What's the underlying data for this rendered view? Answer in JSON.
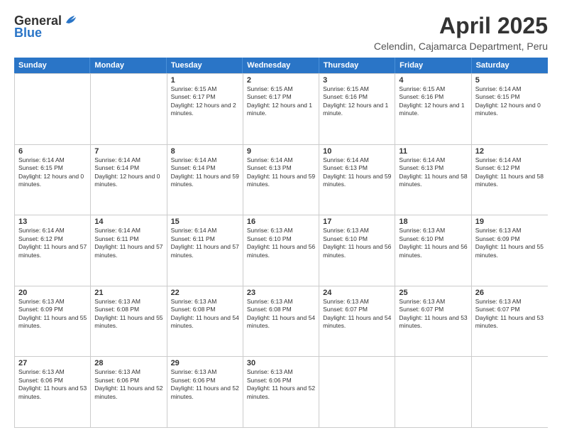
{
  "header": {
    "logo_general": "General",
    "logo_blue": "Blue",
    "main_title": "April 2025",
    "subtitle": "Celendin, Cajamarca Department, Peru"
  },
  "calendar": {
    "days_of_week": [
      "Sunday",
      "Monday",
      "Tuesday",
      "Wednesday",
      "Thursday",
      "Friday",
      "Saturday"
    ],
    "rows": [
      [
        {
          "day": "",
          "empty": true
        },
        {
          "day": "",
          "empty": true
        },
        {
          "day": "1",
          "sunrise": "Sunrise: 6:15 AM",
          "sunset": "Sunset: 6:17 PM",
          "daylight": "Daylight: 12 hours and 2 minutes."
        },
        {
          "day": "2",
          "sunrise": "Sunrise: 6:15 AM",
          "sunset": "Sunset: 6:17 PM",
          "daylight": "Daylight: 12 hours and 1 minute."
        },
        {
          "day": "3",
          "sunrise": "Sunrise: 6:15 AM",
          "sunset": "Sunset: 6:16 PM",
          "daylight": "Daylight: 12 hours and 1 minute."
        },
        {
          "day": "4",
          "sunrise": "Sunrise: 6:15 AM",
          "sunset": "Sunset: 6:16 PM",
          "daylight": "Daylight: 12 hours and 1 minute."
        },
        {
          "day": "5",
          "sunrise": "Sunrise: 6:14 AM",
          "sunset": "Sunset: 6:15 PM",
          "daylight": "Daylight: 12 hours and 0 minutes."
        }
      ],
      [
        {
          "day": "6",
          "sunrise": "Sunrise: 6:14 AM",
          "sunset": "Sunset: 6:15 PM",
          "daylight": "Daylight: 12 hours and 0 minutes."
        },
        {
          "day": "7",
          "sunrise": "Sunrise: 6:14 AM",
          "sunset": "Sunset: 6:14 PM",
          "daylight": "Daylight: 12 hours and 0 minutes."
        },
        {
          "day": "8",
          "sunrise": "Sunrise: 6:14 AM",
          "sunset": "Sunset: 6:14 PM",
          "daylight": "Daylight: 11 hours and 59 minutes."
        },
        {
          "day": "9",
          "sunrise": "Sunrise: 6:14 AM",
          "sunset": "Sunset: 6:13 PM",
          "daylight": "Daylight: 11 hours and 59 minutes."
        },
        {
          "day": "10",
          "sunrise": "Sunrise: 6:14 AM",
          "sunset": "Sunset: 6:13 PM",
          "daylight": "Daylight: 11 hours and 59 minutes."
        },
        {
          "day": "11",
          "sunrise": "Sunrise: 6:14 AM",
          "sunset": "Sunset: 6:13 PM",
          "daylight": "Daylight: 11 hours and 58 minutes."
        },
        {
          "day": "12",
          "sunrise": "Sunrise: 6:14 AM",
          "sunset": "Sunset: 6:12 PM",
          "daylight": "Daylight: 11 hours and 58 minutes."
        }
      ],
      [
        {
          "day": "13",
          "sunrise": "Sunrise: 6:14 AM",
          "sunset": "Sunset: 6:12 PM",
          "daylight": "Daylight: 11 hours and 57 minutes."
        },
        {
          "day": "14",
          "sunrise": "Sunrise: 6:14 AM",
          "sunset": "Sunset: 6:11 PM",
          "daylight": "Daylight: 11 hours and 57 minutes."
        },
        {
          "day": "15",
          "sunrise": "Sunrise: 6:14 AM",
          "sunset": "Sunset: 6:11 PM",
          "daylight": "Daylight: 11 hours and 57 minutes."
        },
        {
          "day": "16",
          "sunrise": "Sunrise: 6:13 AM",
          "sunset": "Sunset: 6:10 PM",
          "daylight": "Daylight: 11 hours and 56 minutes."
        },
        {
          "day": "17",
          "sunrise": "Sunrise: 6:13 AM",
          "sunset": "Sunset: 6:10 PM",
          "daylight": "Daylight: 11 hours and 56 minutes."
        },
        {
          "day": "18",
          "sunrise": "Sunrise: 6:13 AM",
          "sunset": "Sunset: 6:10 PM",
          "daylight": "Daylight: 11 hours and 56 minutes."
        },
        {
          "day": "19",
          "sunrise": "Sunrise: 6:13 AM",
          "sunset": "Sunset: 6:09 PM",
          "daylight": "Daylight: 11 hours and 55 minutes."
        }
      ],
      [
        {
          "day": "20",
          "sunrise": "Sunrise: 6:13 AM",
          "sunset": "Sunset: 6:09 PM",
          "daylight": "Daylight: 11 hours and 55 minutes."
        },
        {
          "day": "21",
          "sunrise": "Sunrise: 6:13 AM",
          "sunset": "Sunset: 6:08 PM",
          "daylight": "Daylight: 11 hours and 55 minutes."
        },
        {
          "day": "22",
          "sunrise": "Sunrise: 6:13 AM",
          "sunset": "Sunset: 6:08 PM",
          "daylight": "Daylight: 11 hours and 54 minutes."
        },
        {
          "day": "23",
          "sunrise": "Sunrise: 6:13 AM",
          "sunset": "Sunset: 6:08 PM",
          "daylight": "Daylight: 11 hours and 54 minutes."
        },
        {
          "day": "24",
          "sunrise": "Sunrise: 6:13 AM",
          "sunset": "Sunset: 6:07 PM",
          "daylight": "Daylight: 11 hours and 54 minutes."
        },
        {
          "day": "25",
          "sunrise": "Sunrise: 6:13 AM",
          "sunset": "Sunset: 6:07 PM",
          "daylight": "Daylight: 11 hours and 53 minutes."
        },
        {
          "day": "26",
          "sunrise": "Sunrise: 6:13 AM",
          "sunset": "Sunset: 6:07 PM",
          "daylight": "Daylight: 11 hours and 53 minutes."
        }
      ],
      [
        {
          "day": "27",
          "sunrise": "Sunrise: 6:13 AM",
          "sunset": "Sunset: 6:06 PM",
          "daylight": "Daylight: 11 hours and 53 minutes."
        },
        {
          "day": "28",
          "sunrise": "Sunrise: 6:13 AM",
          "sunset": "Sunset: 6:06 PM",
          "daylight": "Daylight: 11 hours and 52 minutes."
        },
        {
          "day": "29",
          "sunrise": "Sunrise: 6:13 AM",
          "sunset": "Sunset: 6:06 PM",
          "daylight": "Daylight: 11 hours and 52 minutes."
        },
        {
          "day": "30",
          "sunrise": "Sunrise: 6:13 AM",
          "sunset": "Sunset: 6:06 PM",
          "daylight": "Daylight: 11 hours and 52 minutes."
        },
        {
          "day": "",
          "empty": true
        },
        {
          "day": "",
          "empty": true
        },
        {
          "day": "",
          "empty": true
        }
      ]
    ]
  }
}
